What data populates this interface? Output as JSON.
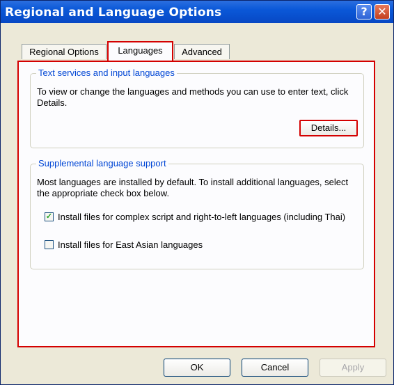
{
  "window": {
    "title": "Regional and Language Options",
    "help_glyph": "?",
    "close_glyph": "✕"
  },
  "tabs": [
    {
      "label": "Regional Options",
      "selected": false
    },
    {
      "label": "Languages",
      "selected": true
    },
    {
      "label": "Advanced",
      "selected": false
    }
  ],
  "text_services": {
    "legend": "Text services and input languages",
    "description": "To view or change the languages and methods you can use to enter text, click Details.",
    "details_button": "Details..."
  },
  "supplemental": {
    "legend": "Supplemental language support",
    "description": "Most languages are installed by default. To install additional languages, select the appropriate check box below.",
    "options": [
      {
        "label": "Install files for complex script and right-to-left languages (including Thai)",
        "checked": true,
        "mark": "✓"
      },
      {
        "label": "Install files for East Asian languages",
        "checked": false,
        "mark": ""
      }
    ]
  },
  "buttons": {
    "ok": "OK",
    "cancel": "Cancel",
    "apply": "Apply"
  },
  "colors": {
    "highlight": "#d40000",
    "title_bar": "#0a58d8",
    "group_legend": "#0046d5"
  }
}
